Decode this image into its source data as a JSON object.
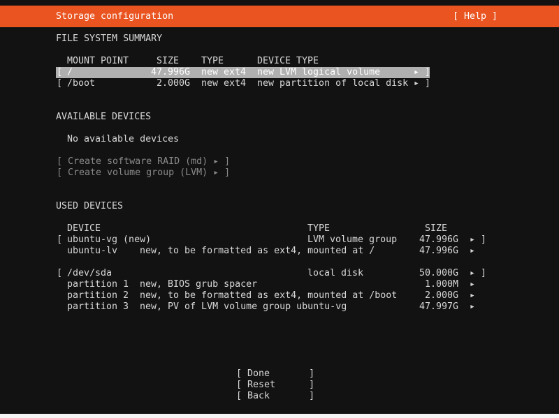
{
  "header": {
    "title": "Storage configuration",
    "help_button": "[ Help ]"
  },
  "fs_summary": {
    "heading": "FILE SYSTEM SUMMARY",
    "columns": {
      "mount": "MOUNT POINT",
      "size": "SIZE",
      "type": "TYPE",
      "device_type": "DEVICE TYPE"
    },
    "rows": [
      {
        "bracket_open": "[",
        "mount": "/",
        "size": "47.996G",
        "type": "new ext4",
        "device_type": "new LVM logical volume",
        "arrow": "▸",
        "bracket_close": "]",
        "selected": true
      },
      {
        "bracket_open": "[",
        "mount": "/boot",
        "size": "2.000G",
        "type": "new ext4",
        "device_type": "new partition of local disk",
        "arrow": "▸",
        "bracket_close": "]",
        "selected": false
      }
    ]
  },
  "available_devices": {
    "heading": "AVAILABLE DEVICES",
    "empty_message": "No available devices",
    "actions": [
      "[ Create software RAID (md) ▸ ]",
      "[ Create volume group (LVM) ▸ ]"
    ]
  },
  "used_devices": {
    "heading": "USED DEVICES",
    "columns": {
      "device": "DEVICE",
      "type": "TYPE",
      "size": "SIZE"
    },
    "groups": [
      {
        "bracket_open": "[",
        "name": "ubuntu-vg (new)",
        "type": "LVM volume group",
        "size": "47.996G",
        "arrow": "▸",
        "bracket_close": "]",
        "children": [
          {
            "name": "ubuntu-lv",
            "desc": "new, to be formatted as ext4, mounted at /",
            "size": "47.996G",
            "arrow": "▸"
          }
        ]
      },
      {
        "bracket_open": "[",
        "name": "/dev/sda",
        "type": "local disk",
        "size": "50.000G",
        "arrow": "▸",
        "bracket_close": "]",
        "children": [
          {
            "name": "partition 1",
            "desc": "new, BIOS grub spacer",
            "size": "1.000M",
            "arrow": "▸"
          },
          {
            "name": "partition 2",
            "desc": "new, to be formatted as ext4, mounted at /boot",
            "size": "2.000G",
            "arrow": "▸"
          },
          {
            "name": "partition 3",
            "desc": "new, PV of LVM volume group ubuntu-vg",
            "size": "47.997G",
            "arrow": "▸"
          }
        ]
      }
    ]
  },
  "footer_buttons": [
    "[ Done       ]",
    "[ Reset      ]",
    "[ Back       ]"
  ],
  "colors": {
    "accent": "#e95420",
    "background": "#121212",
    "text": "#d8d8d8",
    "selection": "#b0b0b0",
    "disabled": "#8a8a8a"
  }
}
